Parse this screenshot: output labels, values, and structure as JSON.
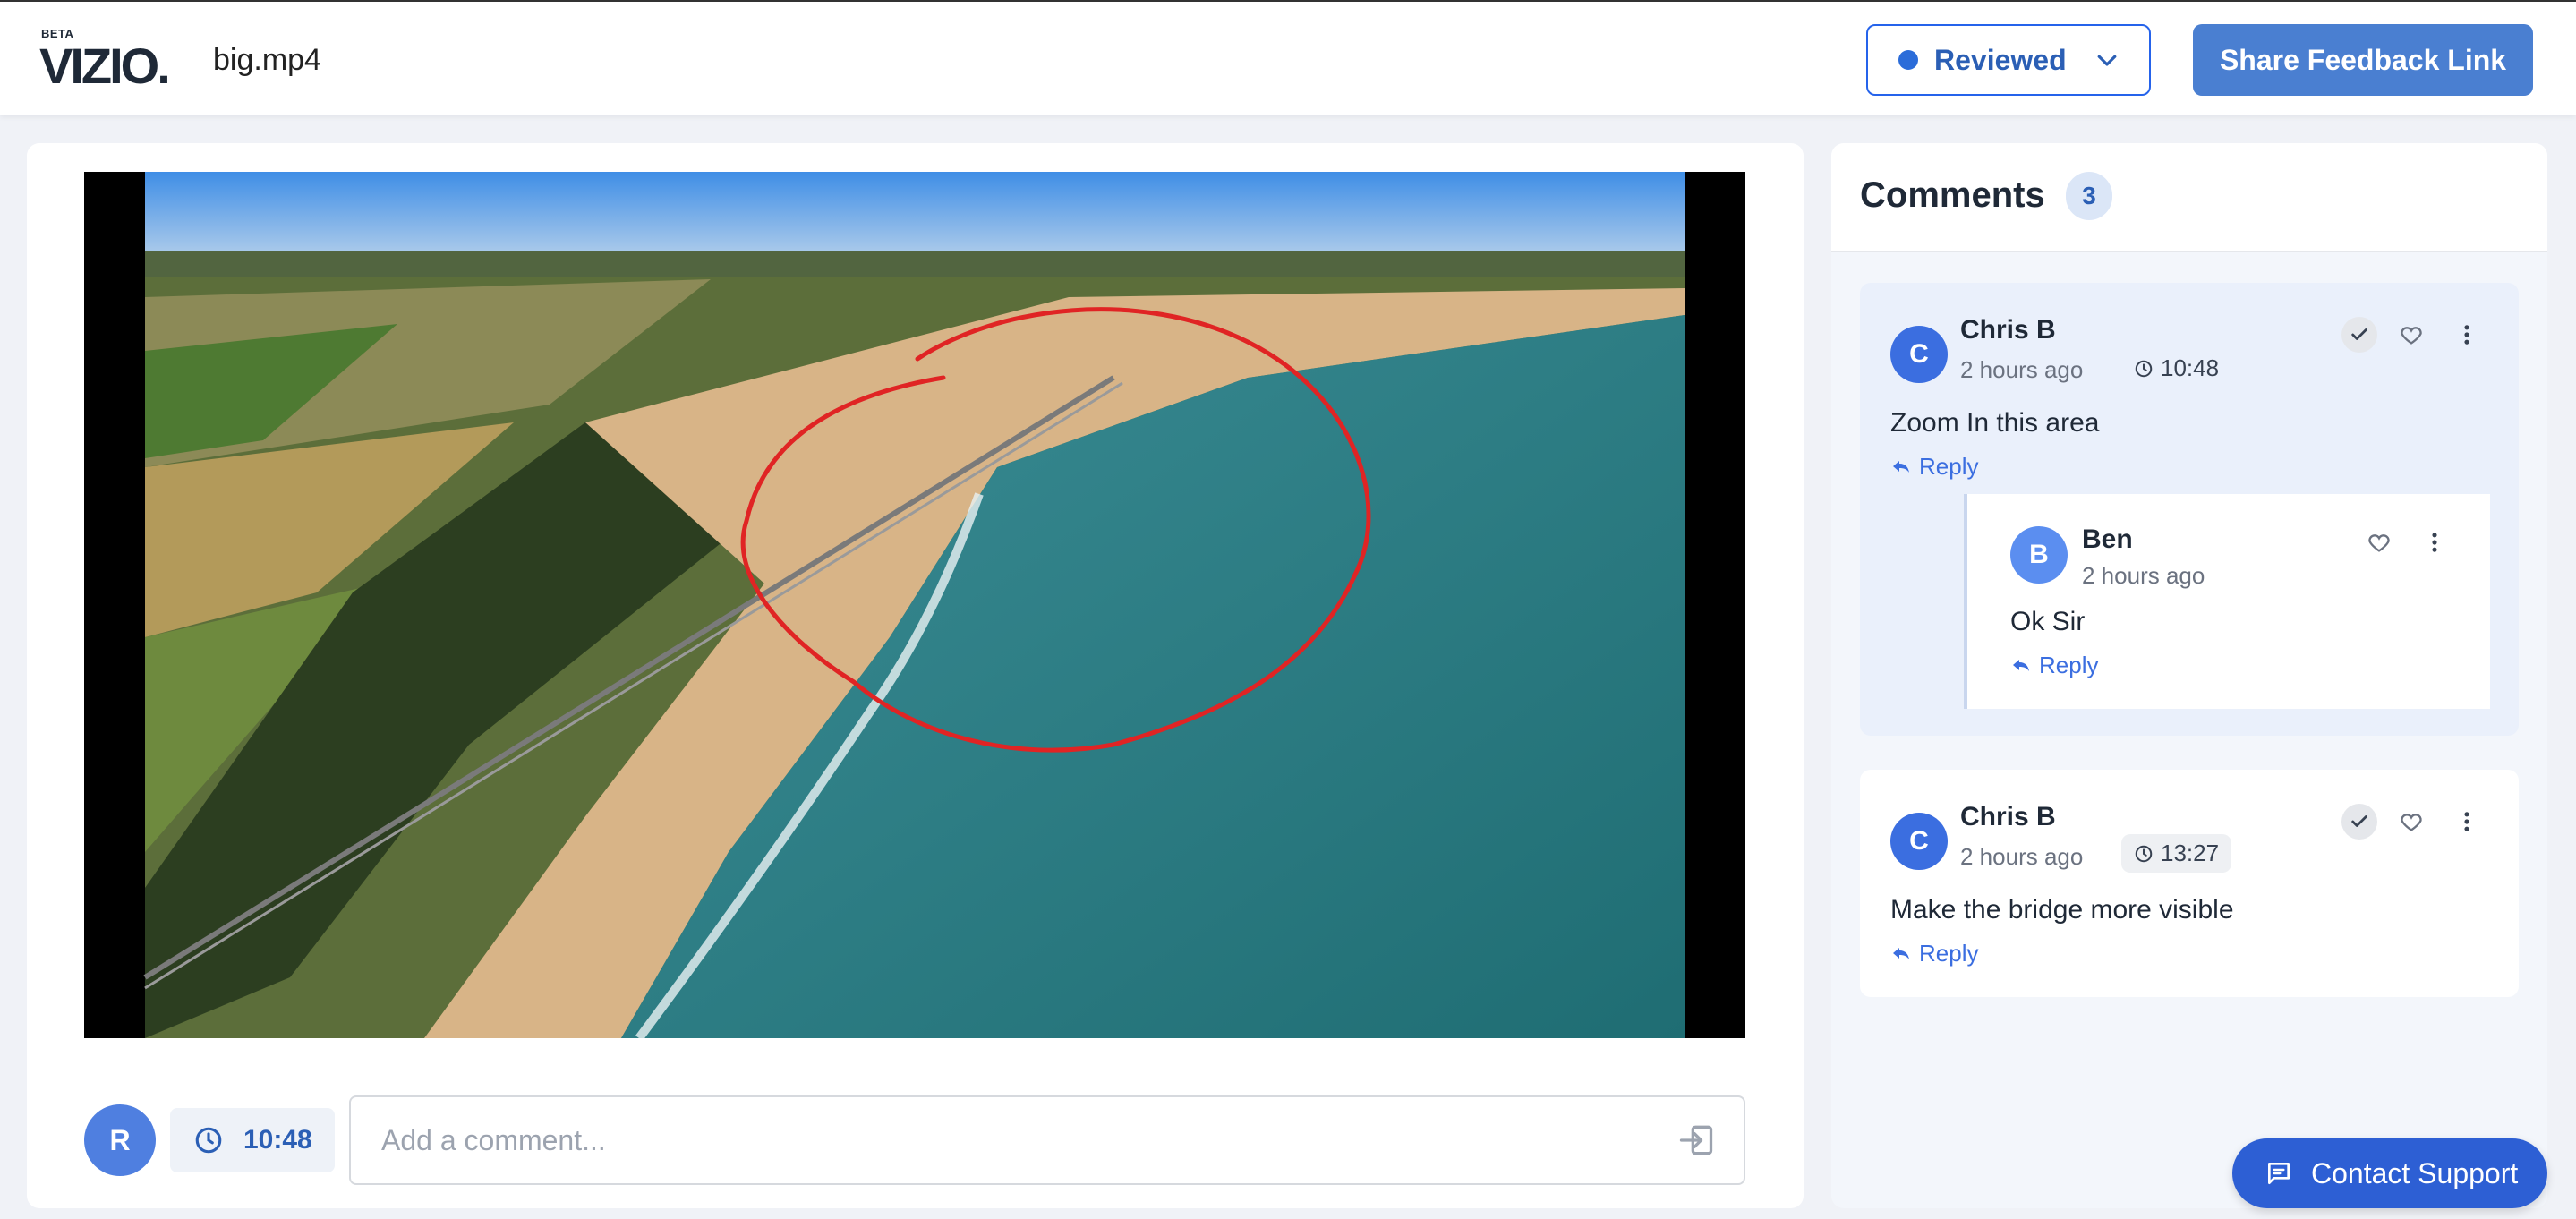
{
  "header": {
    "logo_badge": "BETA",
    "logo_text": "VIZIO.",
    "file_name": "big.mp4",
    "status_label": "Reviewed",
    "share_label": "Share Feedback Link"
  },
  "composer": {
    "avatar_initial": "R",
    "timestamp": "10:48",
    "placeholder": "Add a comment..."
  },
  "comments": {
    "title": "Comments",
    "count": "3",
    "threads": [
      {
        "initial": "C",
        "author": "Chris B",
        "time_ago": "2 hours ago",
        "timestamp": "10:48",
        "text": "Zoom In this area",
        "reply_label": "Reply",
        "replies": [
          {
            "initial": "B",
            "author": "Ben",
            "time_ago": "2 hours ago",
            "text": "Ok Sir",
            "reply_label": "Reply"
          }
        ]
      },
      {
        "initial": "C",
        "author": "Chris B",
        "time_ago": "2 hours ago",
        "timestamp": "13:27",
        "text": "Make the bridge more visible",
        "reply_label": "Reply"
      }
    ]
  },
  "support": {
    "label": "Contact Support"
  },
  "colors": {
    "accent": "#4a7fd1",
    "annotation": "#e02424",
    "sea": "#2f7f84"
  }
}
